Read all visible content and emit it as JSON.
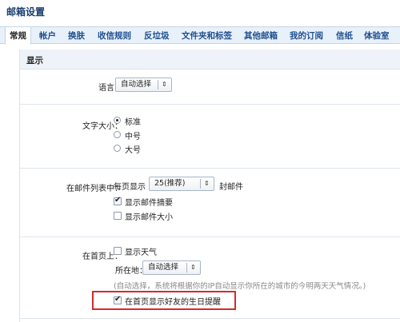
{
  "page": {
    "title": "邮箱设置"
  },
  "tabs": [
    {
      "label": "常规",
      "active": true
    },
    {
      "label": "帐户"
    },
    {
      "label": "换肤"
    },
    {
      "label": "收信规则"
    },
    {
      "label": "反垃圾"
    },
    {
      "label": "文件夹和标签"
    },
    {
      "label": "其他邮箱"
    },
    {
      "label": "我的订阅"
    },
    {
      "label": "信纸"
    },
    {
      "label": "体验室"
    }
  ],
  "section": {
    "title": "显示"
  },
  "language": {
    "label": "语言：",
    "selected": "自动选择"
  },
  "font_size": {
    "label": "文字大小：",
    "options": [
      "标准",
      "中号",
      "大号"
    ],
    "selected_index": 0
  },
  "mail_list": {
    "label": "在邮件列表中：",
    "per_page_prefix": "每页显示",
    "per_page_value": "25(推荐)",
    "per_page_suffix": "封邮件",
    "show_summary": {
      "label": "显示邮件摘要",
      "checked": true
    },
    "show_size": {
      "label": "显示邮件大小",
      "checked": false
    }
  },
  "homepage": {
    "label": "在首页上：",
    "show_weather": {
      "label": "显示天气",
      "checked": false
    },
    "location_label": "所在地：",
    "location_value": "自动选择",
    "hint": "(自动选择，系统将根据你的IP自动显示你所在的城市的今明两天天气情况。)",
    "birthday_reminder": {
      "label": "在首页显示好友的生日提醒",
      "checked": true
    }
  },
  "colors": {
    "tab_bar": "#e8f0f9",
    "link_blue": "#1f4f8f",
    "highlight_red": "#d62a2a"
  },
  "icons": {
    "select_arrow": "up-down-arrow-icon",
    "check": "checkmark-icon"
  }
}
